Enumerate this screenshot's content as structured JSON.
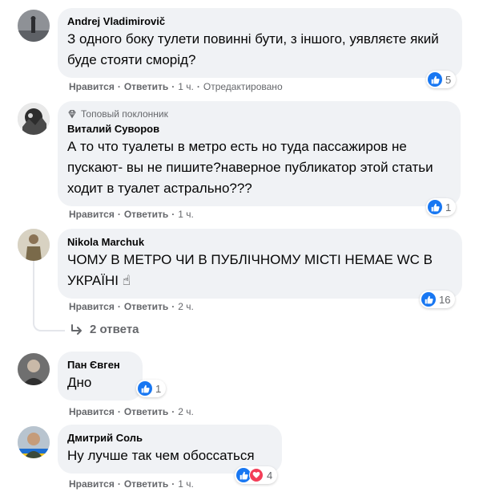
{
  "comments": [
    {
      "author": "Andrej Vladimirovič",
      "badge": "",
      "text": "З одного боку тулети повинні бути, з іншого, уявляєте який буде стояти сморід?",
      "actions": {
        "like": "Нравится",
        "reply": "Ответить",
        "time": "1 ч.",
        "extra": "Отредактировано"
      },
      "reactions": {
        "count": "5",
        "types": [
          "like"
        ]
      }
    },
    {
      "author": "Виталий Суворов",
      "badge": "Топовый поклонник",
      "text": "А то что туалеты в метро есть но туда пассажиров не пускают- вы не пишите?наверное публикатор этой статьи ходит в туалет астрально???",
      "actions": {
        "like": "Нравится",
        "reply": "Ответить",
        "time": "1 ч.",
        "extra": ""
      },
      "reactions": {
        "count": "1",
        "types": [
          "like"
        ]
      }
    },
    {
      "author": "Nikola Marchuk",
      "badge": "",
      "text": "ЧОМУ В МЕТРО ЧИ В ПУБЛІЧНОМУ МІСТІ НЕМАЕ WC В УКРАЇНІ ☝",
      "actions": {
        "like": "Нравится",
        "reply": "Ответить",
        "time": "2 ч.",
        "extra": ""
      },
      "reactions": {
        "count": "16",
        "types": [
          "like"
        ]
      },
      "replies_label": "2 ответа"
    },
    {
      "author": "Пан Євген",
      "badge": "",
      "text": "Дно",
      "actions": {
        "like": "Нравится",
        "reply": "Ответить",
        "time": "2 ч.",
        "extra": ""
      },
      "reactions": {
        "count": "1",
        "types": [
          "like"
        ]
      }
    },
    {
      "author": "Дмитрий Соль",
      "badge": "",
      "text": "Ну лучше так чем обоссаться",
      "actions": {
        "like": "Нравится",
        "reply": "Ответить",
        "time": "1 ч.",
        "extra": ""
      },
      "reactions": {
        "count": "4",
        "types": [
          "like",
          "love"
        ]
      }
    }
  ],
  "colors": {
    "bubble": "#f0f2f5",
    "like": "#1877f2",
    "love": "#f33e58",
    "meta": "#65676b"
  }
}
